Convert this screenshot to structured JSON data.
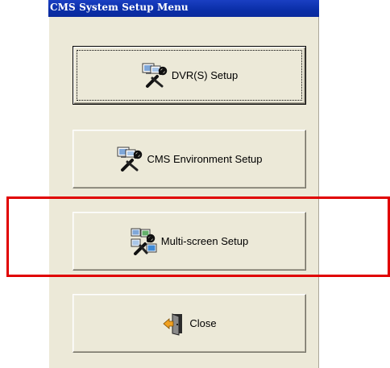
{
  "window": {
    "title": "CMS System Setup Menu"
  },
  "buttons": [
    {
      "label": "DVR(S) Setup",
      "icon": "tools-monitor-icon",
      "default": true
    },
    {
      "label": "CMS Environment Setup",
      "icon": "tools-monitor-icon"
    },
    {
      "label": "Multi-screen Setup",
      "icon": "multi-screen-tools-icon"
    },
    {
      "label": "Close",
      "icon": "exit-door-icon"
    }
  ],
  "highlight": {
    "color": "#E00000",
    "target": "Multi-screen Setup"
  },
  "colors": {
    "title_bar": "#0A2EA8",
    "window_bg": "#ECE9D8"
  }
}
